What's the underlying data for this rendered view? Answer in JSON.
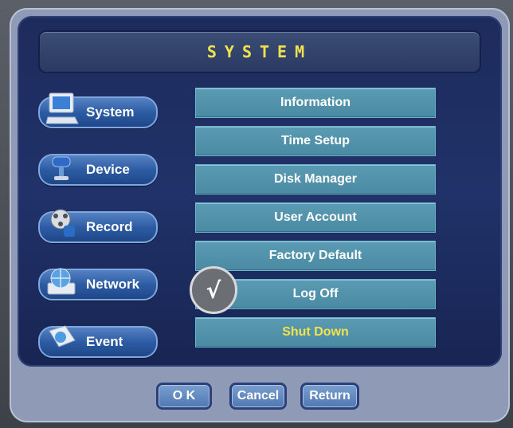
{
  "header": {
    "title": "SYSTEM"
  },
  "sidebar": {
    "items": [
      {
        "label": "System",
        "icon": "computer-icon"
      },
      {
        "label": "Device",
        "icon": "device-icon"
      },
      {
        "label": "Record",
        "icon": "film-reel-icon"
      },
      {
        "label": "Network",
        "icon": "globe-icon"
      },
      {
        "label": "Event",
        "icon": "event-icon"
      }
    ]
  },
  "menu": {
    "items": [
      {
        "label": "Information"
      },
      {
        "label": "Time Setup"
      },
      {
        "label": "Disk Manager"
      },
      {
        "label": "User Account"
      },
      {
        "label": "Factory Default"
      },
      {
        "label": "Log Off"
      },
      {
        "label": "Shut Down"
      }
    ],
    "selected": "Shut Down"
  },
  "cursor": {
    "glyph": "√"
  },
  "footer": {
    "ok_label": "O K",
    "cancel_label": "Cancel",
    "return_label": "Return"
  },
  "colors": {
    "title": "#f2e24e",
    "selected_text": "#f4e24a",
    "panel": "#203269",
    "menu": "#4a8aa4"
  }
}
